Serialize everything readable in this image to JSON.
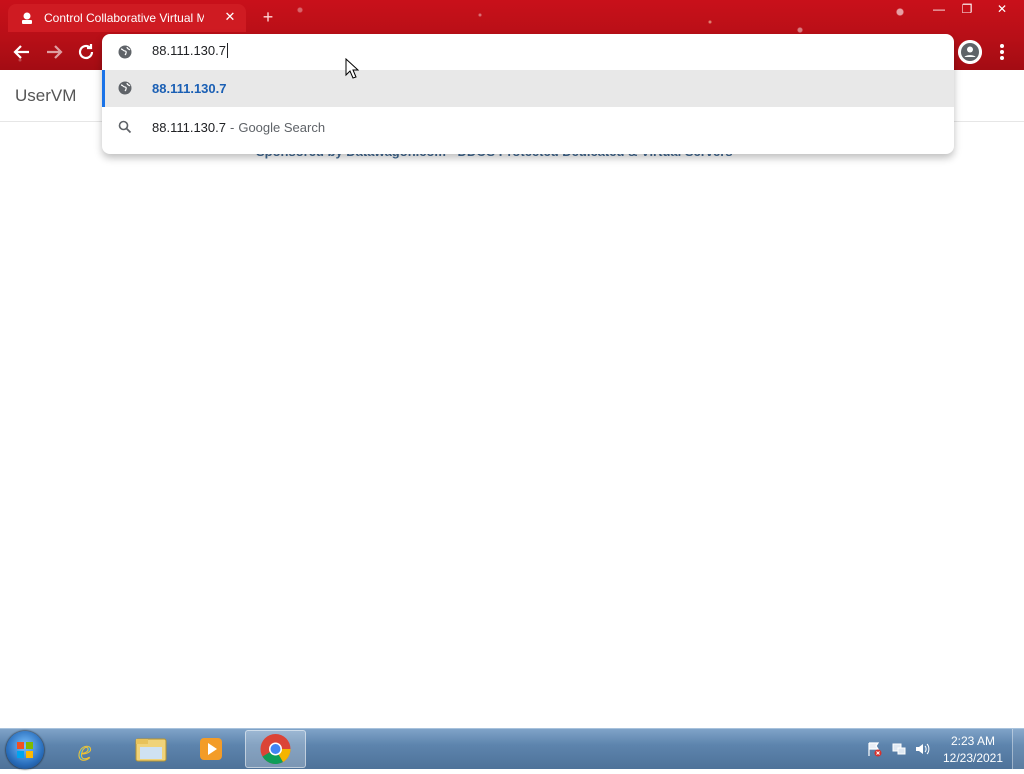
{
  "browser": {
    "tab_title": "Control Collaborative Virtual Ma",
    "tab_close": "✕",
    "new_tab": "+",
    "window": {
      "minimize": "—",
      "maximize": "❐",
      "close": "✕"
    }
  },
  "omnibox": {
    "input_value": "88.111.130.7",
    "suggestions": [
      {
        "icon": "globe-icon",
        "text": "88.111.130.7",
        "selected": true
      },
      {
        "icon": "search-icon",
        "text": "88.111.130.7",
        "separator": "-",
        "engine": "Google Search"
      }
    ]
  },
  "page": {
    "brand": "UserVM",
    "sponsor": "Sponsored by Datawagon.com - DDOS Protected Dedicated & Virtual Servers"
  },
  "taskbar": {
    "apps": [
      "start-orb",
      "internet-explorer-icon",
      "windows-explorer-icon",
      "media-player-icon",
      "chrome-icon"
    ],
    "clock_time": "2:23 AM",
    "clock_date": "12/23/2021"
  },
  "colors": {
    "frame_red": "#b70f17",
    "selection_blue": "#1a73e8",
    "suggestion_text": "#1a5fb4",
    "taskbar": "#5d84ad"
  }
}
